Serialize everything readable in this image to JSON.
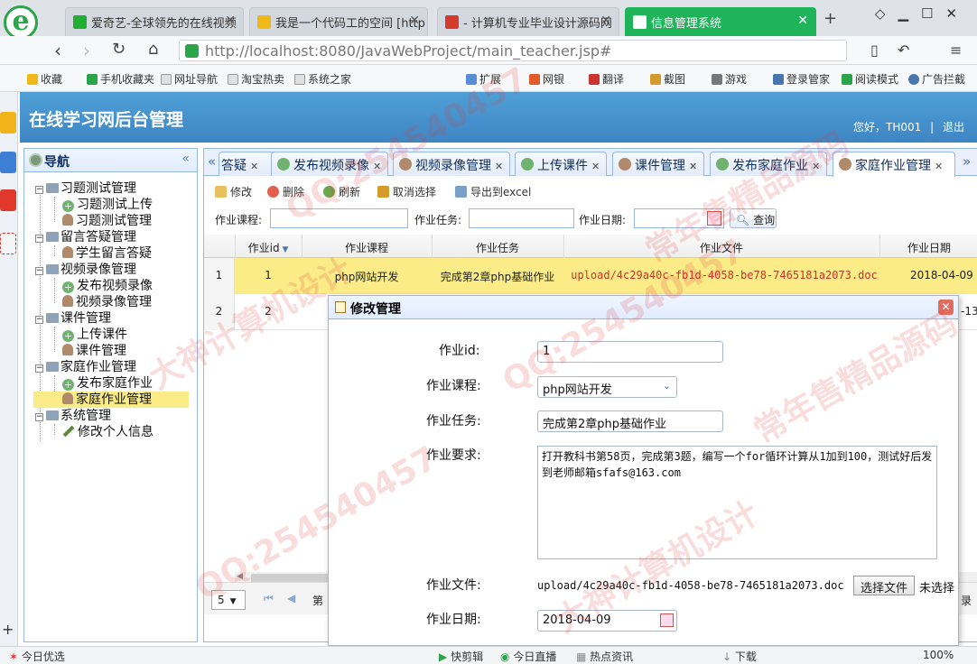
{
  "browser": {
    "tabs": [
      {
        "label": "爱奇艺-全球领先的在线视频",
        "icon_color": "#1fae2f",
        "active": false
      },
      {
        "label": "我是一个代码工的空间 [http",
        "icon_color": "#f0b818",
        "active": false
      },
      {
        "label": "- 计算机专业毕业设计源码网",
        "icon_color": "#d43b2c",
        "active": false
      },
      {
        "label": "信息管理系统",
        "icon_color": "#ffffff",
        "active": true
      }
    ],
    "url_host": "http://localhost",
    "url_rest": ":8080/JavaWebProject/main_teacher.jsp#",
    "bookmarks": [
      "收藏",
      "手机收藏夹",
      "网址导航",
      "淘宝热卖",
      "系统之家",
      "扩展",
      "网银",
      "翻译",
      "截图",
      "游戏",
      "登录管家",
      "阅读模式",
      "广告拦截"
    ]
  },
  "app": {
    "title": "在线学习网后台管理",
    "user_greeting": "您好，TH001",
    "separator": "|",
    "logout": "退出"
  },
  "nav": {
    "title": "导航",
    "collapse": "«",
    "groups": [
      {
        "label": "习题测试管理",
        "children": [
          "习题测试上传",
          "习题测试管理"
        ]
      },
      {
        "label": "留言答疑管理",
        "children": [
          "学生留言答疑"
        ]
      },
      {
        "label": "视频录像管理",
        "children": [
          "发布视频录像",
          "视频录像管理"
        ]
      },
      {
        "label": "课件管理",
        "children": [
          "上传课件",
          "课件管理"
        ]
      },
      {
        "label": "家庭作业管理",
        "children": [
          "发布家庭作业",
          "家庭作业管理"
        ]
      },
      {
        "label": "系统管理",
        "children": [
          "修改个人信息"
        ]
      }
    ]
  },
  "tabs": [
    {
      "label": "答疑"
    },
    {
      "label": "发布视频录像"
    },
    {
      "label": "视频录像管理"
    },
    {
      "label": "上传课件"
    },
    {
      "label": "课件管理"
    },
    {
      "label": "发布家庭作业"
    },
    {
      "label": "家庭作业管理"
    }
  ],
  "toolbar": {
    "edit": "修改",
    "delete": "删除",
    "refresh": "刷新",
    "cancel_select": "取消选择",
    "export": "导出到excel"
  },
  "search": {
    "course_label": "作业课程:",
    "task_label": "作业任务:",
    "date_label": "作业日期:",
    "query_button": "查询"
  },
  "grid": {
    "columns": [
      "作业id",
      "作业课程",
      "作业任务",
      "作业文件",
      "作业日期"
    ],
    "rows": [
      {
        "rownum": "1",
        "id": "1",
        "course": "php网站开发",
        "task": "完成第2章php基础作业",
        "file": "upload/4c29a40c-fb1d-4058-be78-7465181a2073.doc",
        "date": "2018-04-09"
      },
      {
        "rownum": "2",
        "id": "2",
        "course": "",
        "task": "",
        "file": "",
        "date": "-13"
      }
    ]
  },
  "pager": {
    "page_size": "5",
    "page_label": "第",
    "right_text": "录"
  },
  "dialog": {
    "title": "修改管理",
    "fields": {
      "id_label": "作业id:",
      "id_value": "1",
      "course_label": "作业课程:",
      "course_value": "php网站开发",
      "task_label": "作业任务:",
      "task_value": "完成第2章php基础作业",
      "req_label": "作业要求:",
      "req_value": "打开教科书第58页，完成第3题，编写一个for循环计算从1加到100，测试好后发到老师邮箱sfafs@163.com",
      "file_label": "作业文件:",
      "file_value": "upload/4c29a40c-fb1d-4058-be78-7465181a2073.doc",
      "choose_file": "选择文件",
      "no_file": "未选择",
      "date_label": "作业日期:",
      "date_value": "2018-04-09"
    }
  },
  "statusbar": {
    "left": "今日优选",
    "items": [
      "快剪辑",
      "今日直播",
      "热点资讯",
      "下载"
    ],
    "zoom": "100%"
  },
  "watermarks": [
    "QQ:254540457",
    "常年售精品源码",
    "大神计算机设计"
  ]
}
